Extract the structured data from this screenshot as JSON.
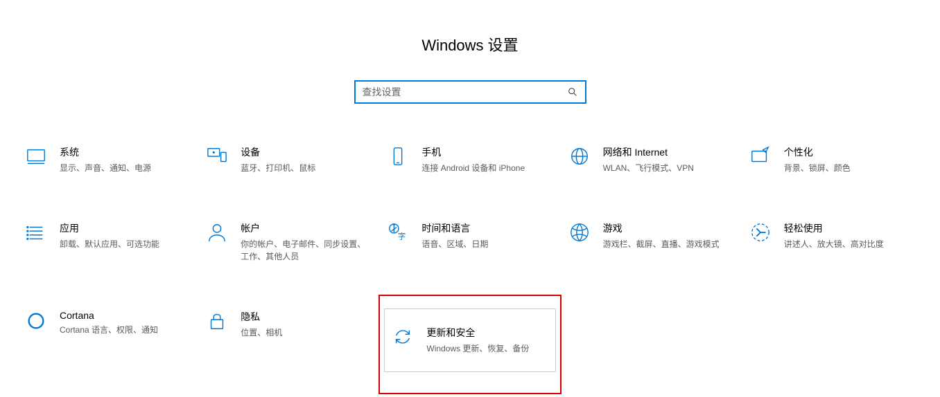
{
  "header": {
    "title": "Windows 设置"
  },
  "search": {
    "placeholder": "查找设置"
  },
  "tiles": {
    "system": {
      "title": "系统",
      "desc": "显示、声音、通知、电源"
    },
    "devices": {
      "title": "设备",
      "desc": "蓝牙、打印机、鼠标"
    },
    "phone": {
      "title": "手机",
      "desc": "连接 Android 设备和 iPhone"
    },
    "network": {
      "title": "网络和 Internet",
      "desc": "WLAN、飞行模式、VPN"
    },
    "personal": {
      "title": "个性化",
      "desc": "背景、锁屏、颜色"
    },
    "apps": {
      "title": "应用",
      "desc": "卸载、默认应用、可选功能"
    },
    "accounts": {
      "title": "帐户",
      "desc": "你的帐户、电子邮件、同步设置、工作、其他人员"
    },
    "time": {
      "title": "时间和语言",
      "desc": "语音、区域、日期"
    },
    "gaming": {
      "title": "游戏",
      "desc": "游戏栏、截屏、直播、游戏模式"
    },
    "ease": {
      "title": "轻松使用",
      "desc": "讲述人、放大镜、高对比度"
    },
    "cortana": {
      "title": "Cortana",
      "desc": "Cortana 语言、权限、通知"
    },
    "privacy": {
      "title": "隐私",
      "desc": "位置、相机"
    },
    "update": {
      "title": "更新和安全",
      "desc": "Windows 更新、恢复、备份"
    }
  }
}
